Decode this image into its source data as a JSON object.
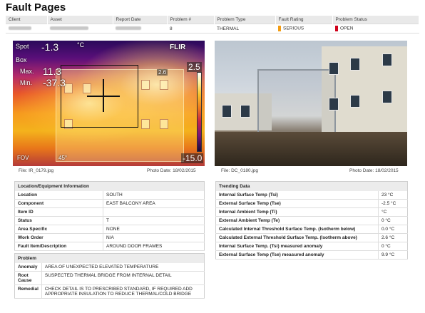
{
  "page_title": "Fault Pages",
  "header": {
    "columns": [
      "Client",
      "Asset",
      "Report Date",
      "Problem #",
      "Problem Type",
      "Fault Rating",
      "Problem Status"
    ],
    "problem_number": "8",
    "problem_type": "THERMAL",
    "fault_rating": "SERIOUS",
    "problem_status": "OPEN",
    "rating_color": "#f39c12",
    "status_color": "#d0021b"
  },
  "thermal": {
    "spot_label": "Spot",
    "spot_value": "-1.3",
    "unit": "°C",
    "box_label": "Box",
    "max_label": "Max.",
    "max_value": "11.3",
    "min_label": "Min.",
    "min_value": "-37.3",
    "brand": "FLIR",
    "scale_top": "2.5",
    "scale_bottom": "-15.0",
    "marker_value": "2.6",
    "fov_label": "FOV",
    "fov_value": "45°"
  },
  "captions": {
    "ir_file": "File: IR_0179.jpg",
    "ir_date": "Photo Date: 18/02/2015",
    "dc_file": "File: DC_0180.jpg",
    "dc_date": "Photo Date: 18/02/2015"
  },
  "location": {
    "title": "Location/Equipment Information",
    "rows": [
      {
        "k": "Location",
        "v": "SOUTH"
      },
      {
        "k": "Component",
        "v": "EAST BALCONY AREA"
      },
      {
        "k": "Item ID",
        "v": ""
      },
      {
        "k": "Status",
        "v": "T"
      },
      {
        "k": "Area Specific",
        "v": "NONE"
      },
      {
        "k": "Work Order",
        "v": "N/A"
      },
      {
        "k": "Fault Item/Description",
        "v": "AROUND DOOR FRAMES"
      }
    ]
  },
  "trending": {
    "title": "Trending Data",
    "rows": [
      {
        "k": "Internal Surface Temp (Tsi)",
        "v": "23 °C"
      },
      {
        "k": "External Surface Temp (Tse)",
        "v": "-2.5 °C"
      },
      {
        "k": "Internal Ambient Temp (Ti)",
        "v": "°C"
      },
      {
        "k": "External Ambient Temp (Te)",
        "v": "0 °C"
      },
      {
        "k": "Calculated Internal Threshold Surface Temp. (Isotherm below)",
        "v": "0.0 °C"
      },
      {
        "k": "Calculated External Threshold Surface Temp. (Isotherm above)",
        "v": "2.6 °C"
      },
      {
        "k": "Internal Surface Temp. (Tsi) measured anomaly",
        "v": "0 °C"
      },
      {
        "k": "External Surface Temp (Tse) measured anomaly",
        "v": "9.9 °C"
      }
    ]
  },
  "problem": {
    "title": "Problem",
    "anomaly_label": "Anomaly",
    "anomaly": "AREA OF UNEXPECTED ELEVATED TEMPERATURE",
    "root_label": "Root Cause",
    "root": "SUSPECTED THERMAL BRIDGE FROM INTERNAL DETAIL",
    "remedial_label": "Remedial",
    "remedial": "CHECK DETAIL IS TO PRESCRIBED STANDARD, IF REQUIRED ADD APPROPRIATE INSULATION TO REDUCE THERMAL/COLD BRIDGE"
  }
}
